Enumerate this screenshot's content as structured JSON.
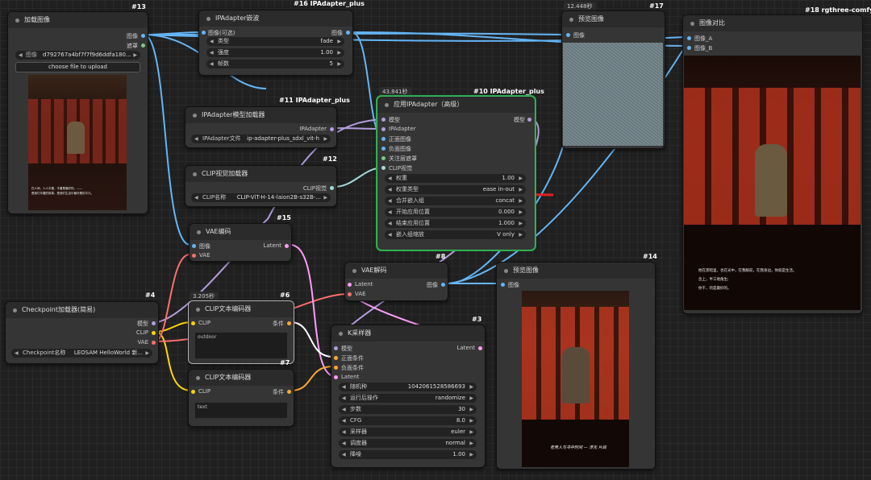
{
  "colors": {
    "image_wire": "#64b5f6",
    "latent_wire": "#ff9cf9",
    "model_wire": "#b39ddb",
    "clip_wire": "#ffd500",
    "vae_wire": "#ff6e6e",
    "cond_wire": "#ffa931",
    "clipvision_wire": "#a8dadc",
    "ipadapter_wire": "#b39ddb",
    "selected_border": "#35c25a",
    "red_annotation": "#e02020"
  },
  "load_image": {
    "title": "加载图像",
    "id": "#13",
    "out_image": "图像",
    "out_mask": "遮罩",
    "widget_label": "图像",
    "widget_value": "d792767a4bf7f7f9d6ddfa180...",
    "upload_button": "choose file to upload",
    "caption_lines": [
      "在人间，人人平庸，平庸是最好的。——",
      "是我们平庸的故事，是我们生活中最朴素的平凡。"
    ]
  },
  "ipa_batch": {
    "title": "IPAdapter嵌波",
    "id": "#16 IPAdapter_plus",
    "in_image": "图像(可选)",
    "out_image": "图像",
    "w_type_label": "类型",
    "w_type_value": "fade",
    "w_strength_label": "强度",
    "w_strength_value": "1.00",
    "w_frames_label": "帧数",
    "w_frames_value": "5"
  },
  "ipa_model_loader": {
    "title": "IPAdapter模型加载器",
    "id": "#11 IPAdapter_plus",
    "out": "IPAdapter",
    "w_label": "IPAdapter文件",
    "w_value": "ip-adapter-plus_sdxl_vit-h"
  },
  "clip_vision_loader": {
    "title": "CLIP视觉加载器",
    "id": "#12",
    "out": "CLIP视觉",
    "w_label": "CLIP名称",
    "w_value": "CLIP-ViT-H-14-laion2B-s32B-..."
  },
  "apply_ipa": {
    "timing": "43.841秒",
    "title": "应用IPAdapter（高级）",
    "id": "#10 IPAdapter_plus",
    "inputs": [
      "模型",
      "IPAdapter",
      "正面图像",
      "负面图像",
      "关注层遮罩",
      "CLIP视觉"
    ],
    "out_model": "模型",
    "widgets": [
      {
        "label": "权重",
        "value": "1.00"
      },
      {
        "label": "权重类型",
        "value": "ease in-out"
      },
      {
        "label": "合并嵌入组",
        "value": "concat"
      },
      {
        "label": "开始应用位置",
        "value": "0.000"
      },
      {
        "label": "结束应用位置",
        "value": "1.000"
      },
      {
        "label": "嵌入组缩放",
        "value": "V only"
      }
    ]
  },
  "preview_17": {
    "timing": "12.448秒",
    "title": "预览图像",
    "id": "#17",
    "in": "图像"
  },
  "compare": {
    "title": "图像对比",
    "id": "#18 rgthree-comfy",
    "in_a": "图像_A",
    "in_b": "图像_B",
    "caption_lines": [
      "他在黑暗里，也在光中，在我眼前，在我身边，你就是生活。",
      "念上，半工地角生;",
      "你干，的是最好的。"
    ]
  },
  "vae_encode": {
    "title": "VAE编码",
    "id": "#15",
    "in_image": "图像",
    "in_vae": "VAE",
    "out": "Latent"
  },
  "vae_decode": {
    "title": "VAE解码",
    "id": "#8",
    "in_latent": "Latent",
    "in_vae": "VAE",
    "out": "图像"
  },
  "preview_14": {
    "title": "预览图像",
    "id": "#14",
    "in": "图像",
    "caption": "老男人与书中时间 — 浮光 片段"
  },
  "checkpoint": {
    "title": "Checkpoint加载器(简易)",
    "id": "#4",
    "out_model": "模型",
    "out_clip": "CLIP",
    "out_vae": "VAE",
    "w_label": "Checkpoint名称",
    "w_value": "LEOSAM HelloWorld 新..."
  },
  "clip_pos": {
    "timing": "3.205秒",
    "title": "CLIP文本编码器",
    "id": "#6",
    "in": "CLIP",
    "out": "条件",
    "text": "outdoor"
  },
  "clip_neg": {
    "title": "CLIP文本编码器",
    "id": "#7",
    "in": "CLIP",
    "out": "条件",
    "text": "text"
  },
  "ksampler": {
    "title": "K采样器",
    "id": "#3",
    "inputs": [
      "模型",
      "正面条件",
      "负面条件",
      "Latent"
    ],
    "out": "Latent",
    "widgets": [
      {
        "label": "随机种",
        "value": "1042061528586693"
      },
      {
        "label": "运行后操作",
        "value": "randomize"
      },
      {
        "label": "步数",
        "value": "30"
      },
      {
        "label": "CFG",
        "value": "8.0"
      },
      {
        "label": "采样器",
        "value": "euler"
      },
      {
        "label": "调度器",
        "value": "normal"
      },
      {
        "label": "降噪",
        "value": "1.00"
      }
    ]
  }
}
